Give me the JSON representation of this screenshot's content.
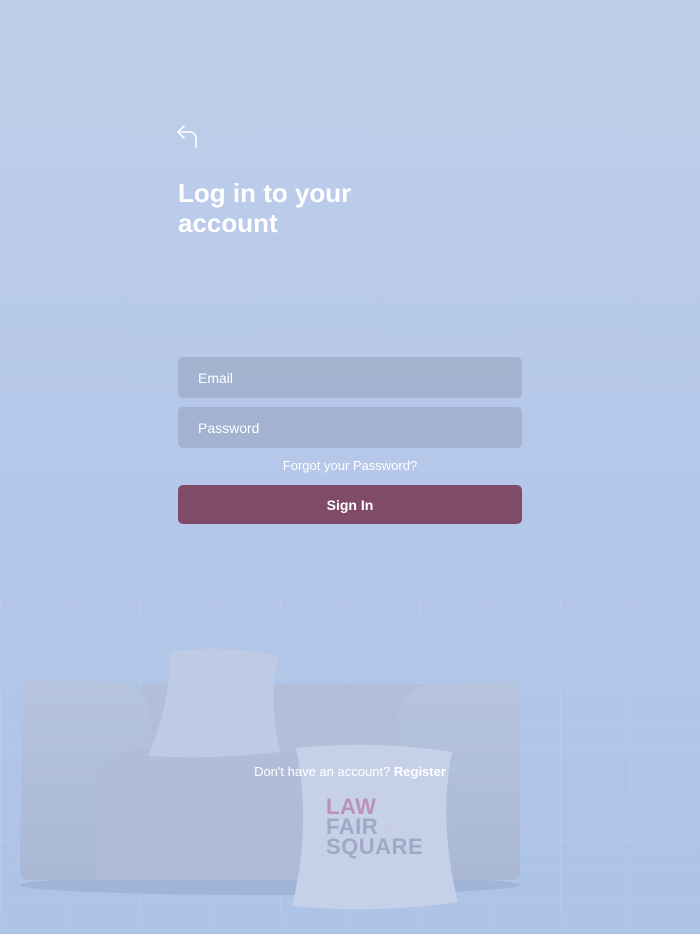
{
  "header": {
    "back_icon": "back-arrow-icon",
    "title": "Log in to your account"
  },
  "form": {
    "email_placeholder": "Email",
    "email_value": "",
    "password_placeholder": "Password",
    "password_value": "",
    "forgot_password_label": "Forgot your Password?",
    "sign_in_label": "Sign In"
  },
  "footer": {
    "no_account_text": "Don't have an account?",
    "register_label": "Register"
  },
  "branding": {
    "logo_line1": "LAW",
    "logo_line2": "FAIR",
    "logo_plus": "+",
    "logo_line3": "SQUARE"
  },
  "colors": {
    "background": "#b8cae9",
    "accent": "#7f4b69",
    "field_background": "#a1b0cc",
    "text": "#ffffff"
  }
}
